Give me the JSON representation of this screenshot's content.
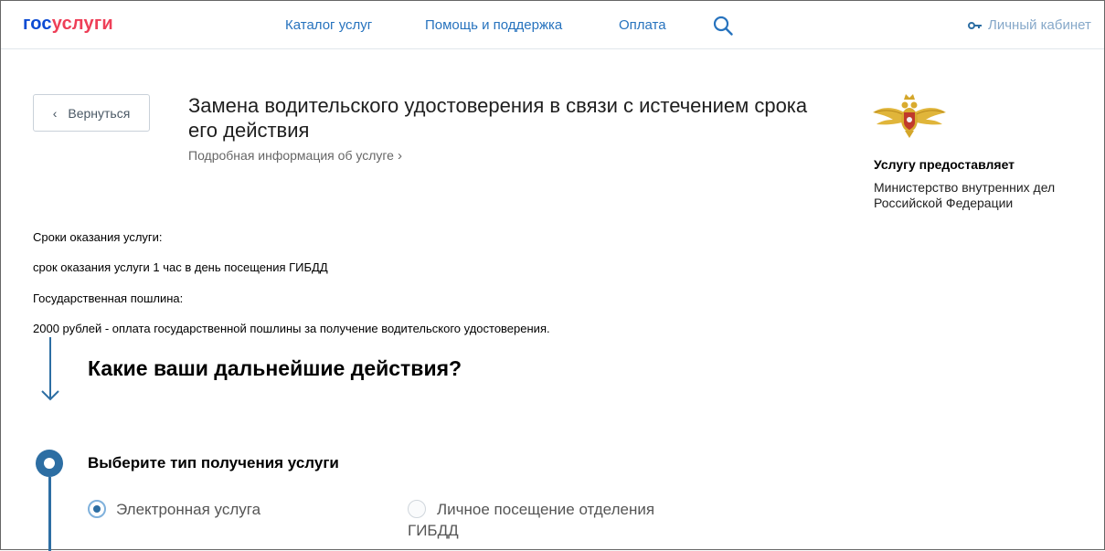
{
  "header": {
    "logo_part1": "гос",
    "logo_part2": "услуги",
    "nav": [
      "Каталог услуг",
      "Помощь и поддержка",
      "Оплата"
    ],
    "cabinet_label": "Личный кабинет"
  },
  "service": {
    "back_label": "Вернуться",
    "title": "Замена водительского удостоверения в связи с истечением срока его действия",
    "more_info": "Подробная информация об услуге"
  },
  "provider": {
    "heading": "Услугу предоставляет",
    "name": "Министерство внутренних дел Российской Федерации"
  },
  "info": [
    "Сроки оказания услуги:",
    "срок оказания услуги 1 час в день посещения ГИБДД",
    "Государственная пошлина:",
    "2000 рублей - оплата государственной пошлины за получение водительского удостоверения."
  ],
  "actions_title": "Какие ваши дальнейшие действия?",
  "step": {
    "title": "Выберите тип получения услуги",
    "options": [
      {
        "label": "Электронная услуга",
        "selected": true
      },
      {
        "label_line1": "Личное посещение отделения",
        "label_line2": "ГИБДД",
        "selected": false
      }
    ]
  },
  "colors": {
    "brand_blue": "#0d4cd3",
    "brand_red": "#ee3f58",
    "link": "#2773be",
    "step_accent": "#2d6ea3"
  }
}
